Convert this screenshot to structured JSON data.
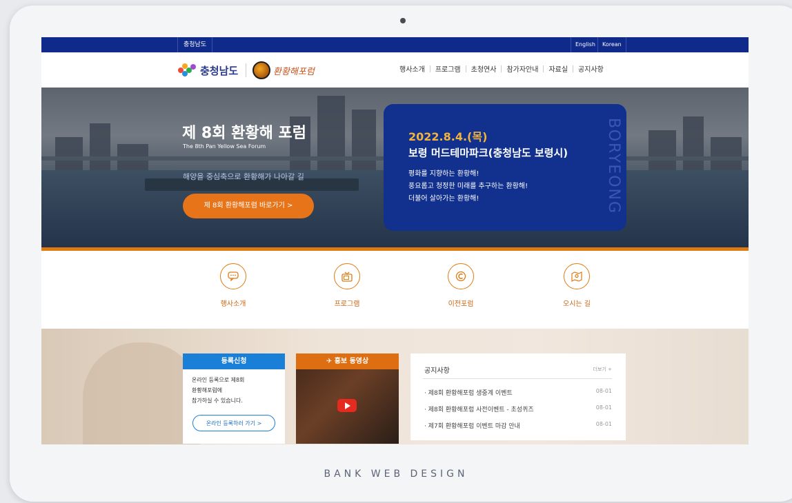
{
  "topbar": {
    "region": "충청남도",
    "lang_en": "English",
    "lang_ko": "Korean"
  },
  "header": {
    "logo_text": "충청남도",
    "forum_logo_text": "환황해포럼",
    "nav": [
      "행사소개",
      "프로그램",
      "초청연사",
      "참가자안내",
      "자료실",
      "공지사항"
    ]
  },
  "hero": {
    "title": "제 8회 환황해 포럼",
    "subtitle": "The 8th Pan Yellow Sea Forum",
    "slogan": "해양을 중심축으로 환황해가 나아갈 길",
    "cta": "제 8회 환황해포럼 바로가기 >"
  },
  "infobox": {
    "date": "2022.8.4.(목)",
    "venue": "보령 머드테마파크(충청남도 보령시)",
    "lines": [
      "평화를 지향하는 환황해!",
      "풍요롭고 청정한 미래를 추구하는 환황해!",
      "더불어 살아가는 환황해!"
    ],
    "vertical": "BORYEONG"
  },
  "quick": [
    {
      "label": "행사소개",
      "icon": "chat-icon"
    },
    {
      "label": "프로그램",
      "icon": "tv-icon"
    },
    {
      "label": "이전포럼",
      "icon": "c-icon"
    },
    {
      "label": "오시는 길",
      "icon": "map-icon"
    }
  ],
  "register": {
    "title": "등록신청",
    "text": [
      "온라인 등록으로 제8회",
      "환황해포럼에",
      "참가하실 수 있습니다."
    ],
    "button": "온라인 등록하러 가기 >"
  },
  "video": {
    "title": "홍보 동영상"
  },
  "notice": {
    "title": "공지사항",
    "more": "더보기 +",
    "items": [
      {
        "text": "· 제8회 환황해포럼 생중계 이벤트",
        "date": "08-01"
      },
      {
        "text": "· 제8회 환황해포럼 사전이벤트 - 초성퀴즈",
        "date": "08-01"
      },
      {
        "text": "· 제7회 환황해포럼 이벤트 마감 안내",
        "date": "08-01"
      }
    ]
  },
  "footer_brand": "BANK WEB DESIGN",
  "colors": {
    "navy": "#0f2a8a",
    "orange": "#e07a12",
    "blue": "#1a7fd6"
  }
}
